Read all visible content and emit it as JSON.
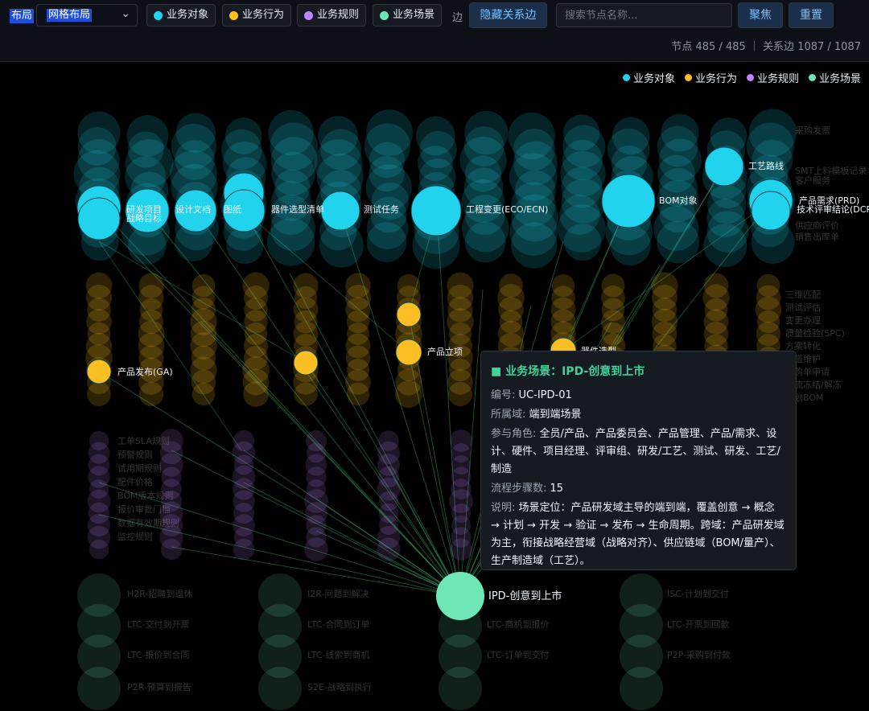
{
  "toolbar": {
    "layout_label": "布局",
    "layout_value": "网格布局",
    "filters": [
      {
        "label": "业务对象",
        "color": "#22d3ee"
      },
      {
        "label": "业务行为",
        "color": "#fbbf24"
      },
      {
        "label": "业务规则",
        "color": "#c084fc"
      },
      {
        "label": "业务场景",
        "color": "#6ee7b7"
      }
    ],
    "edge_label": "边",
    "hide_edges_button": "隐藏关系边",
    "search_placeholder": "搜索节点名称...",
    "focus_button": "聚焦",
    "reset_button": "重置",
    "stats": "节点 485 / 485 ｜ 关系边 1087 / 1087"
  },
  "legend": [
    {
      "label": "业务对象",
      "color": "#22d3ee"
    },
    {
      "label": "业务行为",
      "color": "#fbbf24"
    },
    {
      "label": "业务规则",
      "color": "#c084fc"
    },
    {
      "label": "业务场景",
      "color": "#6ee7b7"
    }
  ],
  "colors": {
    "object": "#22d3ee",
    "action": "#fbbf24",
    "rule": "#c084fc",
    "scene": "#6ee7b7",
    "edge": "#4ade80"
  },
  "graph": {
    "highlighted_objects": [
      "研发项目",
      "战略目标",
      "设计文档",
      "图纸",
      "器件选型清单",
      "测试任务",
      "工程变更(ECO/ECN)",
      "BOM对象",
      "工艺路线",
      "产品需求(PRD)",
      "技术评审结论(DCP)"
    ],
    "faded_objects": [
      "采购发票",
      "SMT上料模板记录",
      "客户服务",
      "供应商评价",
      "销售出库单"
    ],
    "highlighted_actions": [
      "产品发布(GA)",
      "产品立项",
      "器件选型"
    ],
    "faded_actions": [
      "三维匹配",
      "测试评估",
      "变更办理",
      "质量检验(SPC)",
      "方案转化",
      "渠道维护",
      "采购单申请",
      "物流冻结/解冻",
      "计划BOM"
    ],
    "faded_rules": [
      "工单SLA规则",
      "预警规则",
      "试用期规则",
      "配件价格",
      "BOM版本规则",
      "报价审批门槛",
      "数据有效期规则",
      "监控规则"
    ],
    "focus_scene": "IPD-创意到上市",
    "faded_scenes": [
      "H2R-招聘到退休",
      "LTC-交付到开票",
      "LTC-报价到合同",
      "P2R-预算到报告",
      "I2R-问题到解决",
      "LTC-合同到订单",
      "LTC-线索到商机",
      "S2E-战略到执行",
      "LTC-商机到报价",
      "LTC-订单到交付",
      "ISC-计划到交付",
      "LTC-开票到回款",
      "P2P-采购到付款"
    ]
  },
  "tooltip": {
    "title": "■ 业务场景：IPD-创意到上市",
    "code_label": "编号:",
    "code": "UC-IPD-01",
    "domain_label": "所属域:",
    "domain": "端到端场景",
    "roles_label": "参与角色:",
    "roles": "全员/产品、产品委员会、产品管理、产品/需求、设计、硬件、项目经理、评审组、研发/工艺、测试、研发、工艺/制造",
    "steps_label": "流程步骤数:",
    "steps": "15",
    "desc_label": "说明:",
    "desc": "场景定位：产品研发域主导的端到端，覆盖创意 → 概念 → 计划 → 开发 → 验证 → 发布 → 生命周期。跨域：产品研发域为主，衔接战略经营域（战略对齐）、供应链域（BOM/量产）、生产制造域（工艺）。"
  }
}
